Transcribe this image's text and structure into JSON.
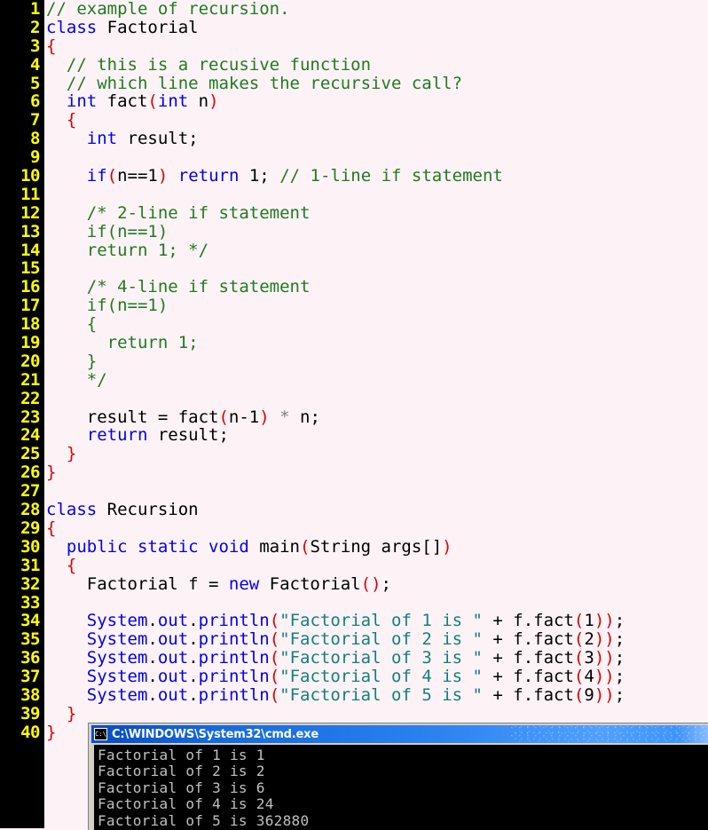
{
  "editor": {
    "language": "java",
    "first_line_number": 1,
    "last_line_number": 40,
    "colors": {
      "gutter_background": "#000000",
      "gutter_text": "#FFFF00",
      "code_background": "#FDF3F7",
      "keyword": "#0000EE",
      "comment": "#207B20",
      "bracket": "#DD0000",
      "string": "#128080",
      "identifier": "#000000",
      "operator": "#808080"
    },
    "line_numbers": [
      "1",
      "2",
      "3",
      "4",
      "5",
      "6",
      "7",
      "8",
      "9",
      "10",
      "11",
      "12",
      "13",
      "14",
      "15",
      "16",
      "17",
      "18",
      "19",
      "20",
      "21",
      "22",
      "23",
      "24",
      "25",
      "26",
      "27",
      "28",
      "29",
      "30",
      "31",
      "32",
      "33",
      "34",
      "35",
      "36",
      "37",
      "38",
      "39",
      "40"
    ],
    "lines": [
      {
        "n": 1,
        "tokens": [
          {
            "t": "// example of recursion.",
            "c": "cmt"
          }
        ]
      },
      {
        "n": 2,
        "tokens": [
          {
            "t": "class",
            "c": "kw"
          },
          {
            "t": " Factorial",
            "c": "id"
          }
        ]
      },
      {
        "n": 3,
        "tokens": [
          {
            "t": "{",
            "c": "pn"
          }
        ]
      },
      {
        "n": 4,
        "tokens": [
          {
            "t": "  ",
            "c": "id"
          },
          {
            "t": "// this is a recusive function",
            "c": "cmt"
          }
        ]
      },
      {
        "n": 5,
        "tokens": [
          {
            "t": "  ",
            "c": "id"
          },
          {
            "t": "// which line makes the recursive call?",
            "c": "cmt"
          }
        ]
      },
      {
        "n": 6,
        "tokens": [
          {
            "t": "  ",
            "c": "id"
          },
          {
            "t": "int",
            "c": "kw"
          },
          {
            "t": " fact",
            "c": "id"
          },
          {
            "t": "(",
            "c": "pn"
          },
          {
            "t": "int",
            "c": "kw"
          },
          {
            "t": " n",
            "c": "id"
          },
          {
            "t": ")",
            "c": "pn"
          }
        ]
      },
      {
        "n": 7,
        "tokens": [
          {
            "t": "  ",
            "c": "id"
          },
          {
            "t": "{",
            "c": "pn"
          }
        ]
      },
      {
        "n": 8,
        "tokens": [
          {
            "t": "    ",
            "c": "id"
          },
          {
            "t": "int",
            "c": "kw"
          },
          {
            "t": " result;",
            "c": "id"
          }
        ]
      },
      {
        "n": 9,
        "tokens": [
          {
            "t": "",
            "c": "id"
          }
        ]
      },
      {
        "n": 10,
        "tokens": [
          {
            "t": "    ",
            "c": "id"
          },
          {
            "t": "if",
            "c": "kw"
          },
          {
            "t": "(",
            "c": "pn"
          },
          {
            "t": "n==1",
            "c": "id"
          },
          {
            "t": ")",
            "c": "pn"
          },
          {
            "t": " ",
            "c": "id"
          },
          {
            "t": "return",
            "c": "kw"
          },
          {
            "t": " 1; ",
            "c": "id"
          },
          {
            "t": "// 1-line if statement",
            "c": "cmt"
          }
        ]
      },
      {
        "n": 11,
        "tokens": [
          {
            "t": "",
            "c": "id"
          }
        ]
      },
      {
        "n": 12,
        "tokens": [
          {
            "t": "    ",
            "c": "id"
          },
          {
            "t": "/* 2-line if statement",
            "c": "cmt"
          }
        ]
      },
      {
        "n": 13,
        "tokens": [
          {
            "t": "    ",
            "c": "id"
          },
          {
            "t": "if(n==1)",
            "c": "cmt"
          }
        ]
      },
      {
        "n": 14,
        "tokens": [
          {
            "t": "    ",
            "c": "id"
          },
          {
            "t": "return 1; */",
            "c": "cmt"
          }
        ]
      },
      {
        "n": 15,
        "tokens": [
          {
            "t": "",
            "c": "id"
          }
        ]
      },
      {
        "n": 16,
        "tokens": [
          {
            "t": "    ",
            "c": "id"
          },
          {
            "t": "/* 4-line if statement",
            "c": "cmt"
          }
        ]
      },
      {
        "n": 17,
        "tokens": [
          {
            "t": "    ",
            "c": "id"
          },
          {
            "t": "if(n==1)",
            "c": "cmt"
          }
        ]
      },
      {
        "n": 18,
        "tokens": [
          {
            "t": "    ",
            "c": "id"
          },
          {
            "t": "{",
            "c": "cmt"
          }
        ]
      },
      {
        "n": 19,
        "tokens": [
          {
            "t": "      ",
            "c": "id"
          },
          {
            "t": "return 1;",
            "c": "cmt"
          }
        ]
      },
      {
        "n": 20,
        "tokens": [
          {
            "t": "    ",
            "c": "id"
          },
          {
            "t": "}",
            "c": "cmt"
          }
        ]
      },
      {
        "n": 21,
        "tokens": [
          {
            "t": "    ",
            "c": "id"
          },
          {
            "t": "*/",
            "c": "cmt"
          }
        ]
      },
      {
        "n": 22,
        "tokens": [
          {
            "t": "",
            "c": "id"
          }
        ]
      },
      {
        "n": 23,
        "tokens": [
          {
            "t": "    result = fact",
            "c": "id"
          },
          {
            "t": "(",
            "c": "pn"
          },
          {
            "t": "n-1",
            "c": "id"
          },
          {
            "t": ")",
            "c": "pn"
          },
          {
            "t": " ",
            "c": "id"
          },
          {
            "t": "*",
            "c": "op"
          },
          {
            "t": " n;",
            "c": "id"
          }
        ]
      },
      {
        "n": 24,
        "tokens": [
          {
            "t": "    ",
            "c": "id"
          },
          {
            "t": "return",
            "c": "kw"
          },
          {
            "t": " result;",
            "c": "id"
          }
        ]
      },
      {
        "n": 25,
        "tokens": [
          {
            "t": "  ",
            "c": "id"
          },
          {
            "t": "}",
            "c": "pn"
          }
        ]
      },
      {
        "n": 26,
        "tokens": [
          {
            "t": "}",
            "c": "pn"
          }
        ]
      },
      {
        "n": 27,
        "tokens": [
          {
            "t": "",
            "c": "id"
          }
        ]
      },
      {
        "n": 28,
        "tokens": [
          {
            "t": "class",
            "c": "kw"
          },
          {
            "t": " Recursion",
            "c": "id"
          }
        ]
      },
      {
        "n": 29,
        "tokens": [
          {
            "t": "{",
            "c": "pn"
          }
        ]
      },
      {
        "n": 30,
        "tokens": [
          {
            "t": "  ",
            "c": "id"
          },
          {
            "t": "public static void",
            "c": "kw"
          },
          {
            "t": " main",
            "c": "id"
          },
          {
            "t": "(",
            "c": "pn"
          },
          {
            "t": "String args[]",
            "c": "id"
          },
          {
            "t": ")",
            "c": "pn"
          }
        ]
      },
      {
        "n": 31,
        "tokens": [
          {
            "t": "  ",
            "c": "id"
          },
          {
            "t": "{",
            "c": "pn"
          }
        ]
      },
      {
        "n": 32,
        "tokens": [
          {
            "t": "    Factorial f = ",
            "c": "id"
          },
          {
            "t": "new",
            "c": "kw"
          },
          {
            "t": " Factorial",
            "c": "id"
          },
          {
            "t": "()",
            "c": "pn"
          },
          {
            "t": ";",
            "c": "id"
          }
        ]
      },
      {
        "n": 33,
        "tokens": [
          {
            "t": "",
            "c": "id"
          }
        ]
      },
      {
        "n": 34,
        "tokens": [
          {
            "t": "    ",
            "c": "id"
          },
          {
            "t": "System",
            "c": "kw"
          },
          {
            "t": ".",
            "c": "id"
          },
          {
            "t": "out",
            "c": "kw"
          },
          {
            "t": ".",
            "c": "id"
          },
          {
            "t": "println",
            "c": "kw"
          },
          {
            "t": "(",
            "c": "pn"
          },
          {
            "t": "\"Factorial of 1 is \"",
            "c": "str"
          },
          {
            "t": " + f.fact",
            "c": "id"
          },
          {
            "t": "(",
            "c": "pn"
          },
          {
            "t": "1",
            "c": "id"
          },
          {
            "t": "))",
            "c": "pn"
          },
          {
            "t": ";",
            "c": "id"
          }
        ]
      },
      {
        "n": 35,
        "tokens": [
          {
            "t": "    ",
            "c": "id"
          },
          {
            "t": "System",
            "c": "kw"
          },
          {
            "t": ".",
            "c": "id"
          },
          {
            "t": "out",
            "c": "kw"
          },
          {
            "t": ".",
            "c": "id"
          },
          {
            "t": "println",
            "c": "kw"
          },
          {
            "t": "(",
            "c": "pn"
          },
          {
            "t": "\"Factorial of 2 is \"",
            "c": "str"
          },
          {
            "t": " + f.fact",
            "c": "id"
          },
          {
            "t": "(",
            "c": "pn"
          },
          {
            "t": "2",
            "c": "id"
          },
          {
            "t": "))",
            "c": "pn"
          },
          {
            "t": ";",
            "c": "id"
          }
        ]
      },
      {
        "n": 36,
        "tokens": [
          {
            "t": "    ",
            "c": "id"
          },
          {
            "t": "System",
            "c": "kw"
          },
          {
            "t": ".",
            "c": "id"
          },
          {
            "t": "out",
            "c": "kw"
          },
          {
            "t": ".",
            "c": "id"
          },
          {
            "t": "println",
            "c": "kw"
          },
          {
            "t": "(",
            "c": "pn"
          },
          {
            "t": "\"Factorial of 3 is \"",
            "c": "str"
          },
          {
            "t": " + f.fact",
            "c": "id"
          },
          {
            "t": "(",
            "c": "pn"
          },
          {
            "t": "3",
            "c": "id"
          },
          {
            "t": "))",
            "c": "pn"
          },
          {
            "t": ";",
            "c": "id"
          }
        ]
      },
      {
        "n": 37,
        "tokens": [
          {
            "t": "    ",
            "c": "id"
          },
          {
            "t": "System",
            "c": "kw"
          },
          {
            "t": ".",
            "c": "id"
          },
          {
            "t": "out",
            "c": "kw"
          },
          {
            "t": ".",
            "c": "id"
          },
          {
            "t": "println",
            "c": "kw"
          },
          {
            "t": "(",
            "c": "pn"
          },
          {
            "t": "\"Factorial of 4 is \"",
            "c": "str"
          },
          {
            "t": " + f.fact",
            "c": "id"
          },
          {
            "t": "(",
            "c": "pn"
          },
          {
            "t": "4",
            "c": "id"
          },
          {
            "t": "))",
            "c": "pn"
          },
          {
            "t": ";",
            "c": "id"
          }
        ]
      },
      {
        "n": 38,
        "tokens": [
          {
            "t": "    ",
            "c": "id"
          },
          {
            "t": "System",
            "c": "kw"
          },
          {
            "t": ".",
            "c": "id"
          },
          {
            "t": "out",
            "c": "kw"
          },
          {
            "t": ".",
            "c": "id"
          },
          {
            "t": "println",
            "c": "kw"
          },
          {
            "t": "(",
            "c": "pn"
          },
          {
            "t": "\"Factorial of 5 is \"",
            "c": "str"
          },
          {
            "t": " + f.fact",
            "c": "id"
          },
          {
            "t": "(",
            "c": "pn"
          },
          {
            "t": "9",
            "c": "id"
          },
          {
            "t": "))",
            "c": "pn"
          },
          {
            "t": ";",
            "c": "id"
          }
        ]
      },
      {
        "n": 39,
        "tokens": [
          {
            "t": "  ",
            "c": "id"
          },
          {
            "t": "}",
            "c": "pn"
          }
        ]
      },
      {
        "n": 40,
        "tokens": [
          {
            "t": "}",
            "c": "pn"
          }
        ]
      }
    ]
  },
  "console": {
    "icon": "cmd-console-icon",
    "icon_label": "C:\\",
    "title": "C:\\WINDOWS\\System32\\cmd.exe",
    "output_lines": [
      "Factorial of 1 is 1",
      "Factorial of 2 is 2",
      "Factorial of 3 is 6",
      "Factorial of 4 is 24",
      "Factorial of 5 is 362880"
    ],
    "colors": {
      "titlebar_start": "#0A50C8",
      "titlebar_end": "#94C4FF",
      "title_text": "#FFFFFF",
      "background": "#000000",
      "text": "#C0C0C0"
    }
  }
}
